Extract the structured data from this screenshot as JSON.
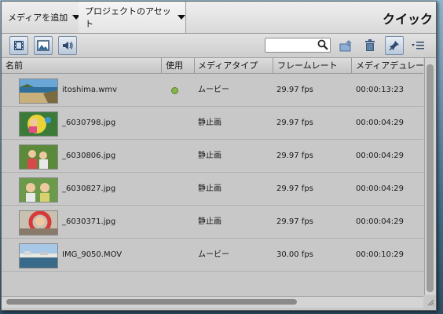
{
  "tabs": {
    "add_media": "メディアを追加",
    "project_assets": "プロジェクトのアセット",
    "quick": "クイック"
  },
  "toolbar": {
    "icons": [
      "film-icon",
      "image-icon",
      "audio-icon",
      "search-icon",
      "upload-icon",
      "trash-icon",
      "pin-icon",
      "menu-icon"
    ],
    "search_placeholder": ""
  },
  "table": {
    "columns": {
      "name": "名前",
      "used": "使用",
      "media_type": "メディアタイプ",
      "frame_rate": "フレームレート",
      "duration": "メディアデュレーショ"
    },
    "rows": [
      {
        "name": "itoshima.wmv",
        "used": true,
        "media_type": "ムービー",
        "frame_rate": "29.97 fps",
        "duration": "00:00:13:23",
        "thumb": "beach"
      },
      {
        "name": "_6030798.jpg",
        "used": false,
        "media_type": "静止画",
        "frame_rate": "29.97 fps",
        "duration": "00:00:04:29",
        "thumb": "kid-green"
      },
      {
        "name": "_6030806.jpg",
        "used": false,
        "media_type": "静止画",
        "frame_rate": "29.97 fps",
        "duration": "00:00:04:29",
        "thumb": "kids-grass"
      },
      {
        "name": "_6030827.jpg",
        "used": false,
        "media_type": "静止画",
        "frame_rate": "29.97 fps",
        "duration": "00:00:04:29",
        "thumb": "kids-grass"
      },
      {
        "name": "_6030371.jpg",
        "used": false,
        "media_type": "静止画",
        "frame_rate": "29.97 fps",
        "duration": "00:00:04:29",
        "thumb": "kid-ring"
      },
      {
        "name": "IMG_9050.MOV",
        "used": false,
        "media_type": "ムービー",
        "frame_rate": "30.00 fps",
        "duration": "00:00:10:29",
        "thumb": "harbor"
      }
    ]
  },
  "colors": {
    "used_dot": "#86b64a",
    "button_blue": "#7a8ea6"
  }
}
